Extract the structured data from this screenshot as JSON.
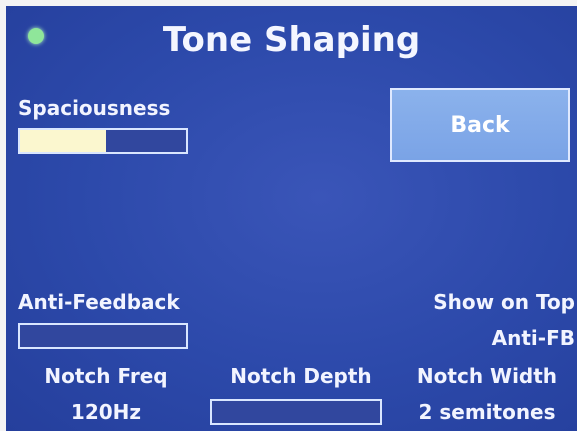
{
  "header": {
    "title": "Tone Shaping"
  },
  "status": {
    "indicator": "green-led",
    "color": "#8fe69a"
  },
  "spaciousness": {
    "label": "Spaciousness",
    "level": 0.52
  },
  "back_button": {
    "label": "Back"
  },
  "anti_feedback": {
    "label": "Anti-Feedback",
    "level": 0
  },
  "show_on_top": {
    "label": "Show on Top",
    "value": "Anti-FB"
  },
  "notch_freq": {
    "label": "Notch Freq",
    "value": "120Hz"
  },
  "notch_depth": {
    "label": "Notch Depth",
    "level": 0
  },
  "notch_width": {
    "label": "Notch Width",
    "value": "2 semitones"
  },
  "colors": {
    "screen_bg": "#2c49aa",
    "fill": "#fbf7cf",
    "button": "#7aa3e6"
  }
}
